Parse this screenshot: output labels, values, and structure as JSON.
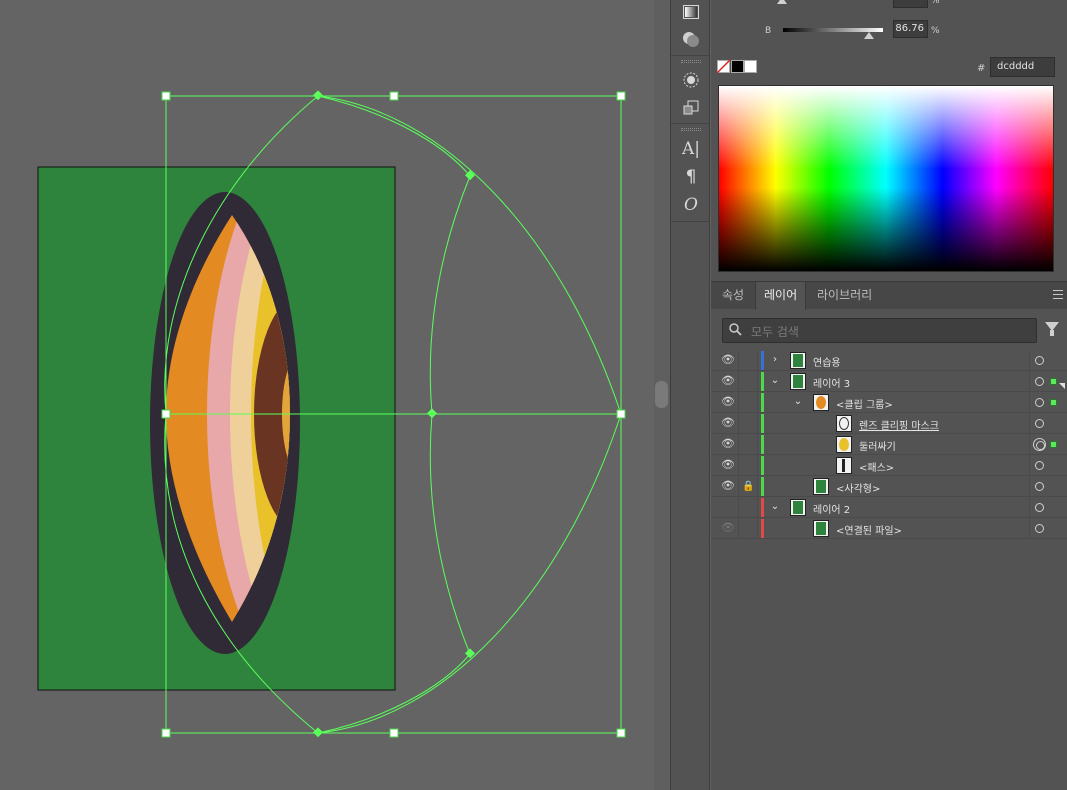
{
  "color_panel": {
    "b_label": "B",
    "b_value": "86.76",
    "percent": "%",
    "hash": "#",
    "hex_value": "dcdddd",
    "fill_color": "#dcdddd"
  },
  "tabs": [
    {
      "label": "속성",
      "active": false
    },
    {
      "label": "레이어",
      "active": true
    },
    {
      "label": "라이브러리",
      "active": false
    }
  ],
  "search": {
    "placeholder": "모두 검색"
  },
  "layers": [
    {
      "name": "연습용",
      "visible": true,
      "locked": false,
      "color": "#3b6fd8",
      "expand": "collapsed",
      "indent": 0,
      "target": "single",
      "selected": false,
      "underline": false
    },
    {
      "name": "레이어 3",
      "visible": true,
      "locked": false,
      "color": "#4ed84e",
      "expand": "expanded",
      "indent": 0,
      "target": "single",
      "selected": true,
      "underline": false
    },
    {
      "name": "<클립 그룹>",
      "visible": true,
      "locked": false,
      "color": "#4ed84e",
      "expand": "expanded",
      "indent": 1,
      "target": "single",
      "selected": true,
      "underline": false
    },
    {
      "name": "렌즈 클리핑 마스크",
      "visible": true,
      "locked": false,
      "color": "#4ed84e",
      "expand": "none",
      "indent": 2,
      "target": "single",
      "selected": false,
      "underline": true
    },
    {
      "name": "둘러싸기",
      "visible": true,
      "locked": false,
      "color": "#4ed84e",
      "expand": "none",
      "indent": 2,
      "target": "double",
      "selected": true,
      "underline": false
    },
    {
      "name": "<패스>",
      "visible": true,
      "locked": false,
      "color": "#4ed84e",
      "expand": "none",
      "indent": 2,
      "target": "single",
      "selected": false,
      "underline": false
    },
    {
      "name": "<사각형>",
      "visible": true,
      "locked": true,
      "color": "#4ed84e",
      "expand": "none",
      "indent": 1,
      "target": "single",
      "selected": false,
      "underline": false
    },
    {
      "name": "레이어 2",
      "visible": false,
      "locked": false,
      "color": "#e04a4a",
      "expand": "expanded",
      "indent": 0,
      "target": "single",
      "selected": false,
      "underline": false
    },
    {
      "name": "<연결된 파일>",
      "visible": false,
      "locked": false,
      "color": "#e04a4a",
      "expand": "none",
      "indent": 1,
      "target": "single",
      "selected": false,
      "underline": false
    }
  ],
  "icons": {
    "eye": "eye-icon",
    "lock": "lock-icon",
    "search": "search-icon",
    "filter": "filter-icon",
    "menu": "panel-menu-icon"
  },
  "artwork": {
    "background": "#2e843c",
    "lens_dark": "#2f2a36",
    "band_colors": [
      "#e38a22",
      "#e8a7a8",
      "#efd09a",
      "#e9c12b",
      "#2a8a3f",
      "#6a3422"
    ],
    "selection_color": "#5aff5a"
  }
}
